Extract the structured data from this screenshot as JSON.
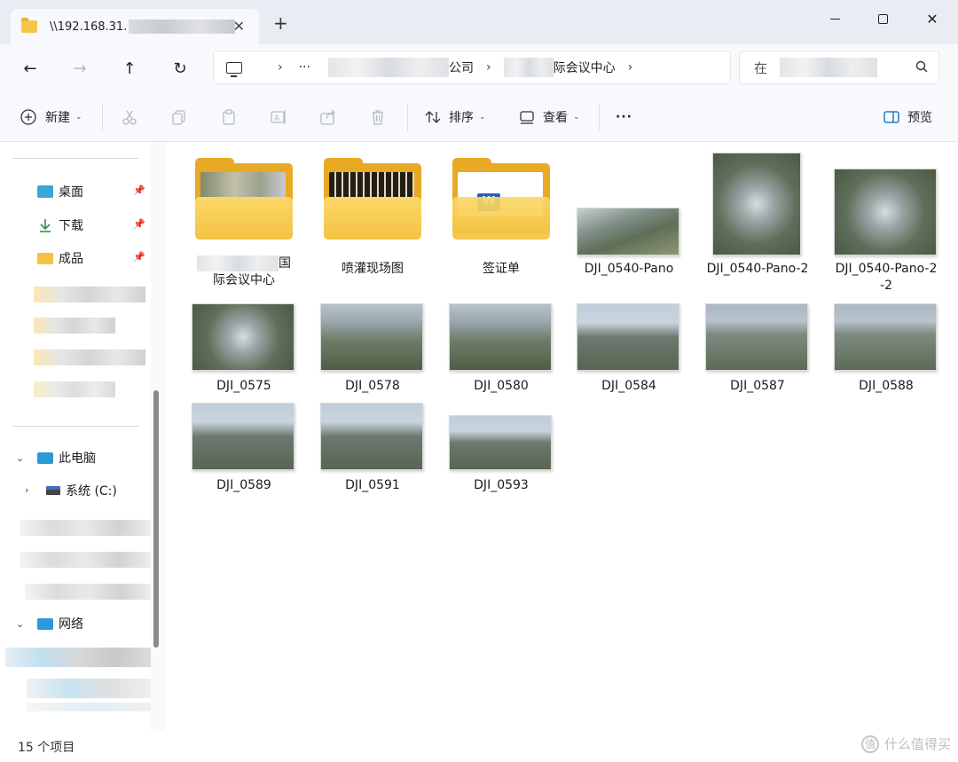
{
  "tab": {
    "title": "\\\\192.168.31.",
    "close": "✕",
    "new_tab": "+"
  },
  "window": {
    "minimize": "",
    "maximize": "",
    "close": "✕"
  },
  "nav": {
    "back": "←",
    "forward": "→",
    "up": "↑",
    "refresh": "↻",
    "more": "···",
    "crumb1": "公司",
    "crumb2": "际会议中心",
    "search_placeholder": "在"
  },
  "toolbar": {
    "new": "新建",
    "sort": "排序",
    "view": "查看",
    "more": "···",
    "preview": "预览"
  },
  "sidebar": {
    "desktop": "桌面",
    "downloads": "下载",
    "finished": "成品",
    "this_pc": "此电脑",
    "system_c": "系统 (C:)",
    "network": "网络"
  },
  "items": {
    "folder1_line1": "国",
    "folder1_line2": "际会议中心",
    "folder2": "喷灌现场图",
    "folder3": "签证单",
    "img1": "DJI_0540-Pano",
    "img2": "DJI_0540-Pano-2",
    "img3_line1": "DJI_0540-Pano-2",
    "img3_line2": "-2",
    "img4": "DJI_0575",
    "img5": "DJI_0578",
    "img6": "DJI_0580",
    "img7": "DJI_0584",
    "img8": "DJI_0587",
    "img9": "DJI_0588",
    "img10": "DJI_0589",
    "img11": "DJI_0591",
    "img12": "DJI_0593"
  },
  "status": {
    "count": "15 个项目",
    "watermark": "什么值得买",
    "watermark_glyph": "值"
  },
  "colors": {
    "folder": "#f4c242",
    "accent": "#0067c0"
  }
}
